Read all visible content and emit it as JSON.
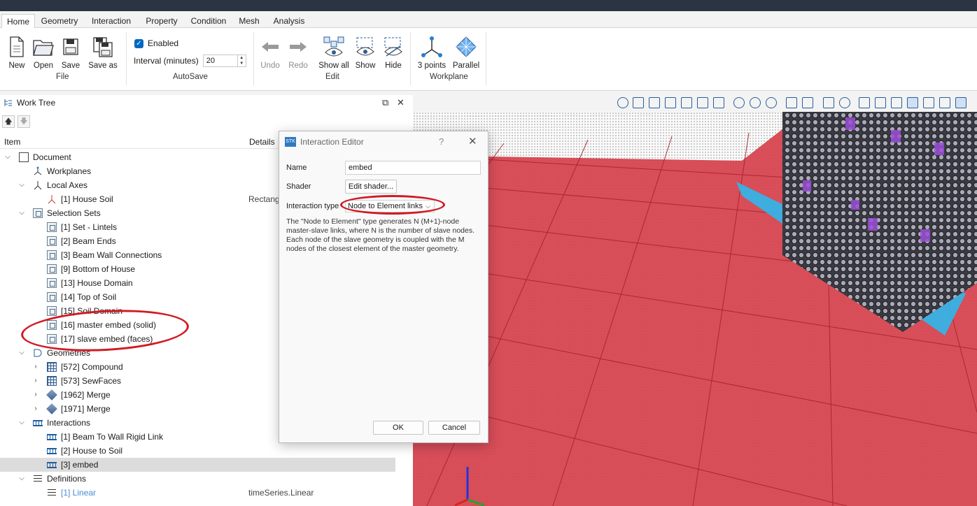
{
  "tabs": [
    "Home",
    "Geometry",
    "Interaction",
    "Property",
    "Condition",
    "Mesh",
    "Analysis"
  ],
  "ribbon": {
    "file": {
      "new": "New",
      "open": "Open",
      "save": "Save",
      "save_as": "Save as",
      "group": "File"
    },
    "autosave": {
      "enabled_label": "Enabled",
      "interval_label": "Interval (minutes)",
      "interval_value": "20",
      "group": "AutoSave"
    },
    "edit": {
      "undo": "Undo",
      "redo": "Redo",
      "show_all": "Show all",
      "show": "Show",
      "hide": "Hide",
      "group": "Edit"
    },
    "workplane": {
      "three_points": "3 points",
      "parallel": "Parallel",
      "group": "Workplane"
    }
  },
  "worktree": {
    "title": "Work Tree",
    "col_item": "Item",
    "col_details": "Details",
    "rows": [
      {
        "label": "Document"
      },
      {
        "label": "Workplanes"
      },
      {
        "label": "Local Axes"
      },
      {
        "label": "[1] House Soil",
        "details": "Rectang"
      },
      {
        "label": "Selection Sets"
      },
      {
        "label": "[1] Set - Lintels"
      },
      {
        "label": "[2] Beam Ends"
      },
      {
        "label": "[3] Beam Wall Connections"
      },
      {
        "label": "[9] Bottom of House"
      },
      {
        "label": "[13] House Domain"
      },
      {
        "label": "[14] Top of Soil"
      },
      {
        "label": "[15] Soil Domain"
      },
      {
        "label": "[16] master embed (solid)"
      },
      {
        "label": "[17] slave embed (faces)"
      },
      {
        "label": "Geometries"
      },
      {
        "label": "[572] Compound"
      },
      {
        "label": "[573] SewFaces"
      },
      {
        "label": "[1962] Merge"
      },
      {
        "label": "[1971] Merge"
      },
      {
        "label": "Interactions"
      },
      {
        "label": "[1] Beam To Wall Rigid Link"
      },
      {
        "label": "[2] House to Soil"
      },
      {
        "label": "[3] embed"
      },
      {
        "label": "Definitions"
      },
      {
        "label": "[1] Linear",
        "details": "timeSeries.Linear"
      }
    ]
  },
  "dialog": {
    "title": "Interaction Editor",
    "help": "?",
    "close": "✕",
    "name_label": "Name",
    "name_value": "embed",
    "shader_label": "Shader",
    "shader_button": "Edit shader...",
    "type_label": "Interaction type",
    "type_value": "Node to Element links",
    "description": "The \"Node to Element\" type generates N (M+1)-node master-slave links, where N is the number of slave nodes. Each node of the slave geometry is coupled with the M nodes of the closest element of the master geometry.",
    "ok": "OK",
    "cancel": "Cancel"
  },
  "colors": {
    "accent": "#0067c0",
    "annotation": "#d11a24",
    "soil": "#e0414a",
    "embed_faces": "#2fb8ec"
  }
}
